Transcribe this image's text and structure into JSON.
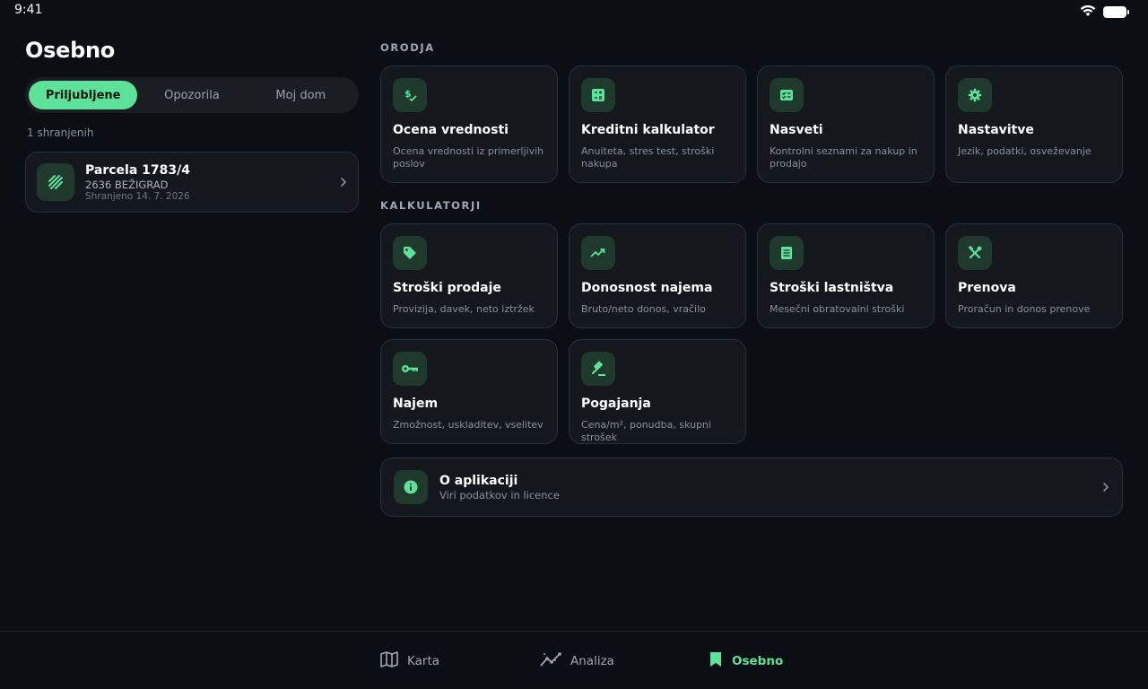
{
  "status": {
    "time": "9:41"
  },
  "page": {
    "title": "Osebno"
  },
  "tabs": [
    {
      "label": "Priljubljene",
      "active": true
    },
    {
      "label": "Opozorila",
      "active": false
    },
    {
      "label": "Moj dom",
      "active": false
    }
  ],
  "saved": {
    "count_text": "1 shranjenih",
    "items": [
      {
        "title": "Parcela 1783/4",
        "subtitle": "2636 BEŽIGRAD",
        "date": "Shranjeno 14. 7. 2026",
        "icon": "parcel-icon"
      }
    ]
  },
  "tools": {
    "label": "ORODJA",
    "items": [
      {
        "title": "Ocena vrednosti",
        "desc": "Ocena vrednosti iz primerljivih poslov",
        "icon": "price-check-icon"
      },
      {
        "title": "Kreditni kalkulator",
        "desc": "Anuiteta, stres test, stroški nakupa",
        "icon": "calculator-icon"
      },
      {
        "title": "Nasveti",
        "desc": "Kontrolni seznami za nakup in prodajo",
        "icon": "checklist-icon"
      },
      {
        "title": "Nastavitve",
        "desc": "Jezik, podatki, osveževanje",
        "icon": "gear-icon"
      }
    ]
  },
  "calculators": {
    "label": "KALKULATORJI",
    "items": [
      {
        "title": "Stroški prodaje",
        "desc": "Provizija, davek, neto iztržek",
        "icon": "tag-icon"
      },
      {
        "title": "Donosnost najema",
        "desc": "Bruto/neto donos, vračilo",
        "icon": "trend-up-icon"
      },
      {
        "title": "Stroški lastništva",
        "desc": "Mesečni obratovalni stroški",
        "icon": "receipt-icon"
      },
      {
        "title": "Prenova",
        "desc": "Proračun in donos prenove",
        "icon": "tools-icon"
      },
      {
        "title": "Najem",
        "desc": "Zmožnost, uskladitev, vselitev",
        "icon": "key-icon"
      },
      {
        "title": "Pogajanja",
        "desc": "Cena/m², ponudba, skupni strošek",
        "icon": "gavel-icon"
      }
    ]
  },
  "about": {
    "title": "O aplikaciji",
    "subtitle": "Viri podatkov in licence",
    "icon": "info-icon"
  },
  "nav": [
    {
      "label": "Karta",
      "icon": "map-icon",
      "active": false
    },
    {
      "label": "Analiza",
      "icon": "analytics-icon",
      "active": false
    },
    {
      "label": "Osebno",
      "icon": "bookmark-icon",
      "active": true
    }
  ],
  "colors": {
    "accent": "#5ee29a",
    "background": "#0b0e12",
    "card": "#14181c",
    "icon_bg": "#1f3a2c"
  }
}
